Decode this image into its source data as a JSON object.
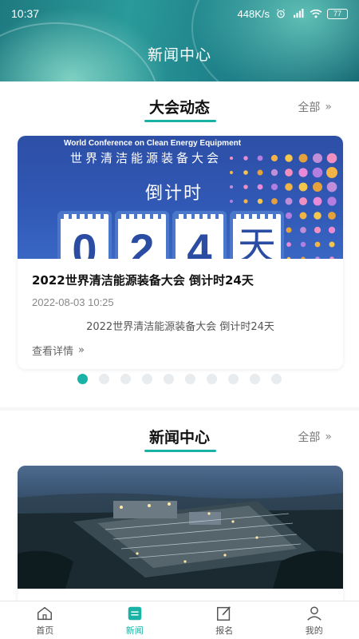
{
  "status_bar": {
    "time": "10:37",
    "network_speed": "448K/s",
    "battery": "77"
  },
  "header": {
    "title": "新闻中心"
  },
  "conference_section": {
    "title": "大会动态",
    "more_label": "全部",
    "card": {
      "banner_en": "World Conference on Clean Energy Equipment",
      "banner_cn": "世界清洁能源装备大会",
      "banner_countdown": "倒计时",
      "digits": [
        "0",
        "2",
        "4"
      ],
      "unit": "天",
      "title": "2022世界清洁能源装备大会 倒计时24天",
      "date": "2022-08-03 10:25",
      "summary": "2022世界清洁能源装备大会 倒计时24天",
      "detail_label": "查看详情"
    },
    "pager": {
      "total": 10,
      "active_index": 0
    }
  },
  "news_section": {
    "title": "新闻中心",
    "more_label": "全部"
  },
  "bottom_nav": {
    "items": [
      {
        "label": "首页",
        "icon": "home-icon",
        "active": false
      },
      {
        "label": "新闻",
        "icon": "news-icon",
        "active": true
      },
      {
        "label": "报名",
        "icon": "signup-icon",
        "active": false
      },
      {
        "label": "我的",
        "icon": "profile-icon",
        "active": false
      }
    ]
  },
  "colors": {
    "accent": "#18b3a6",
    "header": "#1e7a80",
    "banner": "#2d4fa6"
  }
}
